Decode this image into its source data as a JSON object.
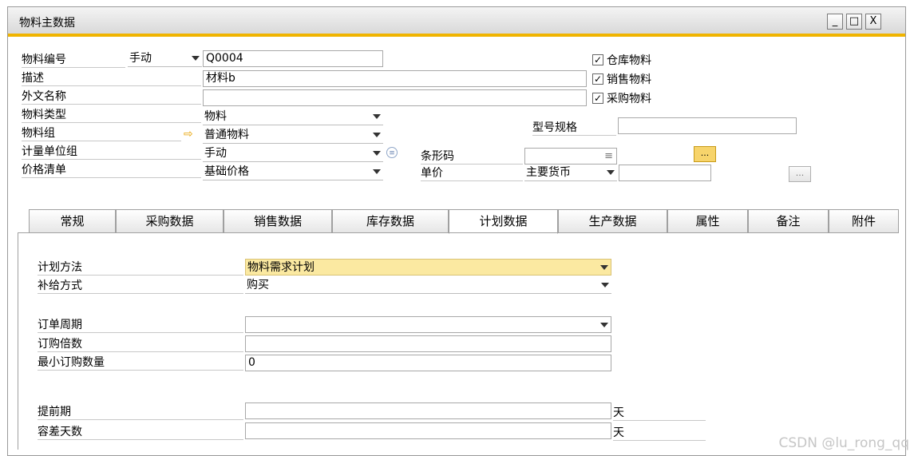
{
  "window": {
    "title": "物料主数据",
    "controls": {
      "minimize": "_",
      "maximize": "□",
      "close": "X"
    }
  },
  "header": {
    "item_code": {
      "label": "物料编号",
      "series": "手动",
      "value": "Q0004"
    },
    "description": {
      "label": "描述",
      "value": "材料b"
    },
    "foreign_name": {
      "label": "外文名称",
      "value": ""
    },
    "item_type": {
      "label": "物料类型",
      "value": "物料"
    },
    "item_group": {
      "label": "物料组",
      "value": "普通物料",
      "link_icon": "arrow-right-icon"
    },
    "uom_group": {
      "label": "计量单位组",
      "value": "手动",
      "info_icon": "info-list-icon"
    },
    "price_list": {
      "label": "价格清单",
      "value": "基础价格"
    },
    "barcode": {
      "label": "条形码",
      "value": "",
      "mark": "≡"
    },
    "unit_price": {
      "label": "单价",
      "currency": "主要货币",
      "value": ""
    },
    "model_spec": {
      "label": "型号规格",
      "value": ""
    },
    "checkboxes": [
      {
        "label": "仓库物料",
        "checked": true
      },
      {
        "label": "销售物料",
        "checked": true
      },
      {
        "label": "采购物料",
        "checked": true
      }
    ],
    "more_button_label": "...",
    "disabled_more_button_label": "..."
  },
  "tabs": [
    {
      "label": "常规",
      "active": false
    },
    {
      "label": "采购数据",
      "active": false
    },
    {
      "label": "销售数据",
      "active": false
    },
    {
      "label": "库存数据",
      "active": false
    },
    {
      "label": "计划数据",
      "active": true
    },
    {
      "label": "生产数据",
      "active": false
    },
    {
      "label": "属性",
      "active": false
    },
    {
      "label": "备注",
      "active": false
    },
    {
      "label": "附件",
      "active": false
    }
  ],
  "planning": {
    "planning_method": {
      "label": "计划方法",
      "value": "物料需求计划"
    },
    "procurement_method": {
      "label": "补给方式",
      "value": "购买"
    },
    "order_interval": {
      "label": "订单周期",
      "value": ""
    },
    "order_multiple": {
      "label": "订购倍数",
      "value": ""
    },
    "min_order_qty": {
      "label": "最小订购数量",
      "value": "0"
    },
    "lead_time": {
      "label": "提前期",
      "value": "",
      "unit": "天"
    },
    "tolerance_days": {
      "label": "容差天数",
      "value": "",
      "unit": "天"
    }
  },
  "watermark": "CSDN @lu_rong_qq",
  "colors": {
    "accent": "#f0b400",
    "highlight_field": "#fbe9a1"
  }
}
